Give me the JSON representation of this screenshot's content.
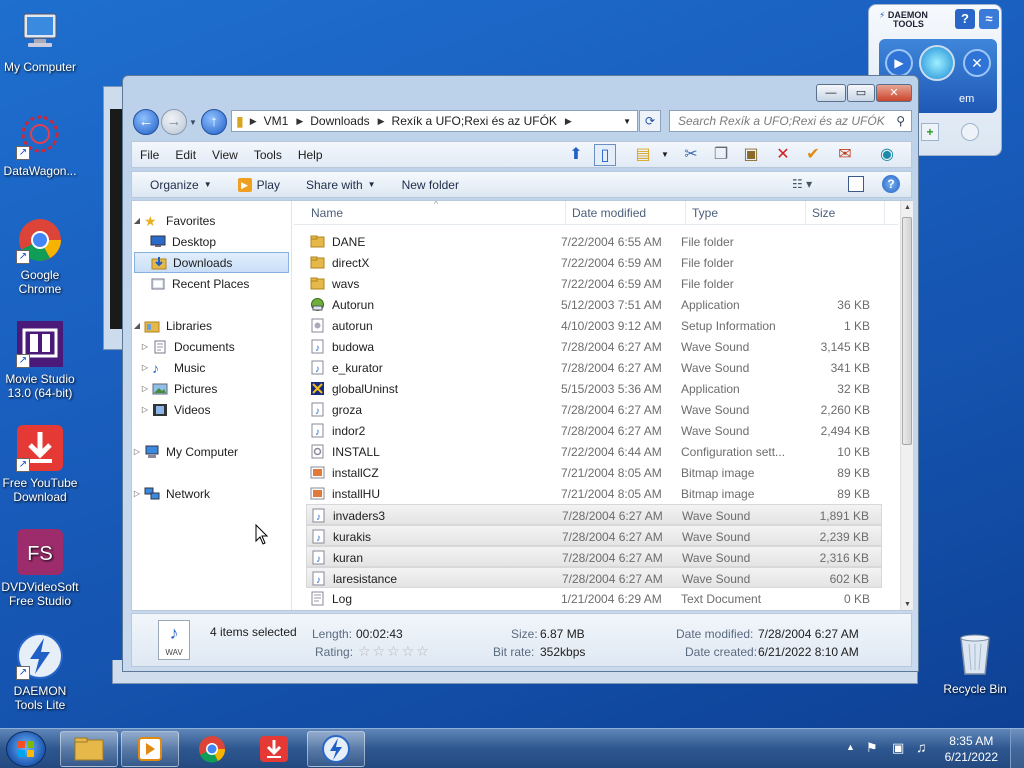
{
  "desktop": {
    "icons": [
      {
        "label": "My Computer"
      },
      {
        "label": "DataWagon..."
      },
      {
        "label": "Google Chrome"
      },
      {
        "label": "Movie Studio 13.0 (64-bit)"
      },
      {
        "label": "Free YouTube Download"
      },
      {
        "label": "DVDVideoSoft Free Studio"
      },
      {
        "label": "DAEMON Tools Lite"
      },
      {
        "label": "Recycle Bin"
      }
    ]
  },
  "daemon_gadget": {
    "title_line1": "DAEMON",
    "title_line2": "TOOLS",
    "help": "?",
    "panel_text": "em"
  },
  "explorer": {
    "breadcrumb": [
      "VM1",
      "Downloads",
      "Rexík a UFO;Rexi és az UFÓK"
    ],
    "search_placeholder": "Search Rexík a UFO;Rexi és az UFÓK",
    "menu": [
      "File",
      "Edit",
      "View",
      "Tools",
      "Help"
    ],
    "commands": {
      "organize": "Organize",
      "play": "Play",
      "share_with": "Share with",
      "new_folder": "New folder"
    },
    "nav_pane": {
      "favorites": "Favorites",
      "desktop": "Desktop",
      "downloads": "Downloads",
      "recent_places": "Recent Places",
      "libraries": "Libraries",
      "documents": "Documents",
      "music": "Music",
      "pictures": "Pictures",
      "videos": "Videos",
      "my_computer": "My Computer",
      "network": "Network"
    },
    "columns": {
      "name": "Name",
      "date": "Date modified",
      "type": "Type",
      "size": "Size"
    },
    "files": [
      {
        "name": "DANE",
        "date": "7/22/2004 6:55 AM",
        "type": "File folder",
        "size": "",
        "icon": "folder-icon",
        "selected": false
      },
      {
        "name": "directX",
        "date": "7/22/2004 6:59 AM",
        "type": "File folder",
        "size": "",
        "icon": "folder-icon",
        "selected": false
      },
      {
        "name": "wavs",
        "date": "7/22/2004 6:59 AM",
        "type": "File folder",
        "size": "",
        "icon": "folder-icon",
        "selected": false
      },
      {
        "name": "Autorun",
        "date": "5/12/2003 7:51 AM",
        "type": "Application",
        "size": "36 KB",
        "icon": "app-icon",
        "selected": false
      },
      {
        "name": "autorun",
        "date": "4/10/2003 9:12 AM",
        "type": "Setup Information",
        "size": "1 KB",
        "icon": "setup-icon",
        "selected": false
      },
      {
        "name": "budowa",
        "date": "7/28/2004 6:27 AM",
        "type": "Wave Sound",
        "size": "3,145 KB",
        "icon": "wave-icon",
        "selected": false
      },
      {
        "name": "e_kurator",
        "date": "7/28/2004 6:27 AM",
        "type": "Wave Sound",
        "size": "341 KB",
        "icon": "wave-icon",
        "selected": false
      },
      {
        "name": "globalUninst",
        "date": "5/15/2003 5:36 AM",
        "type": "Application",
        "size": "32 KB",
        "icon": "uninstall-icon",
        "selected": false
      },
      {
        "name": "groza",
        "date": "7/28/2004 6:27 AM",
        "type": "Wave Sound",
        "size": "2,260 KB",
        "icon": "wave-icon",
        "selected": false
      },
      {
        "name": "indor2",
        "date": "7/28/2004 6:27 AM",
        "type": "Wave Sound",
        "size": "2,494 KB",
        "icon": "wave-icon",
        "selected": false
      },
      {
        "name": "INSTALL",
        "date": "7/22/2004 6:44 AM",
        "type": "Configuration sett...",
        "size": "10 KB",
        "icon": "config-icon",
        "selected": false
      },
      {
        "name": "installCZ",
        "date": "7/21/2004 8:05 AM",
        "type": "Bitmap image",
        "size": "89 KB",
        "icon": "bitmap-icon",
        "selected": false
      },
      {
        "name": "installHU",
        "date": "7/21/2004 8:05 AM",
        "type": "Bitmap image",
        "size": "89 KB",
        "icon": "bitmap-icon",
        "selected": false
      },
      {
        "name": "invaders3",
        "date": "7/28/2004 6:27 AM",
        "type": "Wave Sound",
        "size": "1,891 KB",
        "icon": "wave-icon",
        "selected": true
      },
      {
        "name": "kurakis",
        "date": "7/28/2004 6:27 AM",
        "type": "Wave Sound",
        "size": "2,239 KB",
        "icon": "wave-icon",
        "selected": true
      },
      {
        "name": "kuran",
        "date": "7/28/2004 6:27 AM",
        "type": "Wave Sound",
        "size": "2,316 KB",
        "icon": "wave-icon",
        "selected": true
      },
      {
        "name": "laresistance",
        "date": "7/28/2004 6:27 AM",
        "type": "Wave Sound",
        "size": "602 KB",
        "icon": "wave-icon",
        "selected": true
      },
      {
        "name": "Log",
        "date": "1/21/2004 6:29 AM",
        "type": "Text Document",
        "size": "0 KB",
        "icon": "text-icon",
        "selected": false
      }
    ],
    "details": {
      "icon_caption": "WAV",
      "count": "4 items selected",
      "length_label": "Length:",
      "length": "00:02:43",
      "rating_label": "Rating:",
      "size_label": "Size:",
      "size": "6.87 MB",
      "bitrate_label": "Bit rate:",
      "bitrate": "352kbps",
      "modified_label": "Date modified:",
      "modified": "7/28/2004 6:27 AM",
      "created_label": "Date created:",
      "created": "6/21/2022 8:10 AM",
      "rating_value": 0,
      "rating_max": 5
    }
  },
  "taskbar": {
    "time": "8:35 AM",
    "date": "6/21/2022"
  },
  "colors": {
    "desktop_blue": "#1a5fbf",
    "selection_blue": "#c9dff7",
    "window_chrome": "#bcd2ea"
  }
}
